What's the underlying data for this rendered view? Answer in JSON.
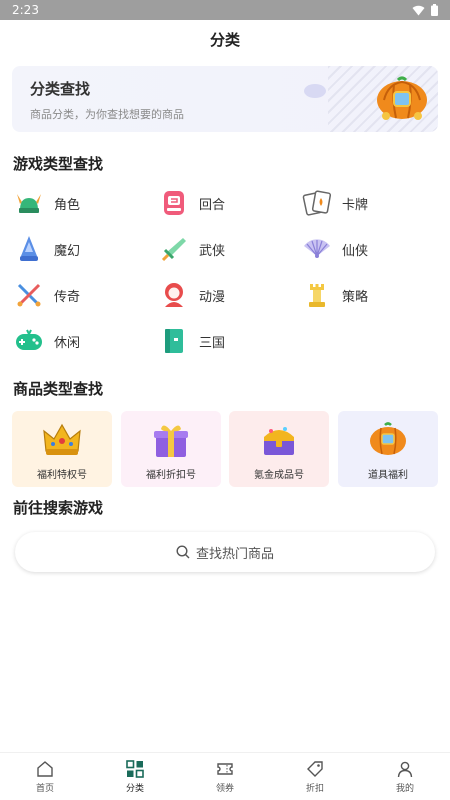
{
  "status": {
    "time": "2:23"
  },
  "header": {
    "title": "分类"
  },
  "banner": {
    "title": "分类查找",
    "subtitle": "商品分类，为你查找想要的商品"
  },
  "game_section": {
    "title": "游戏类型查找",
    "items": [
      {
        "label": "角色",
        "icon": "viking-helmet-icon"
      },
      {
        "label": "回合",
        "icon": "arcade-machine-icon"
      },
      {
        "label": "卡牌",
        "icon": "playing-card-icon"
      },
      {
        "label": "魔幻",
        "icon": "wizard-hat-icon"
      },
      {
        "label": "武侠",
        "icon": "sword-icon"
      },
      {
        "label": "仙侠",
        "icon": "folding-fan-icon"
      },
      {
        "label": "传奇",
        "icon": "crossed-swords-icon"
      },
      {
        "label": "动漫",
        "icon": "anime-character-icon"
      },
      {
        "label": "策略",
        "icon": "chess-rook-icon"
      },
      {
        "label": "休闲",
        "icon": "gamepad-icon"
      },
      {
        "label": "三国",
        "icon": "book-icon"
      }
    ]
  },
  "product_section": {
    "title": "商品类型查找",
    "items": [
      {
        "label": "福利特权号",
        "icon": "crown-icon",
        "bg": "#fff3e2"
      },
      {
        "label": "福利折扣号",
        "icon": "gift-box-icon",
        "bg": "#fdf0f8"
      },
      {
        "label": "氪金成品号",
        "icon": "treasure-chest-icon",
        "bg": "#fdecec"
      },
      {
        "label": "道具福利",
        "icon": "pumpkin-carriage-icon",
        "bg": "#eff0fc"
      }
    ]
  },
  "search_section": {
    "title": "前往搜索游戏",
    "placeholder": "查找热门商品"
  },
  "tabbar": {
    "active": "分类",
    "items": [
      {
        "label": "首页",
        "icon": "home-icon"
      },
      {
        "label": "分类",
        "icon": "category-grid-icon"
      },
      {
        "label": "领券",
        "icon": "coupon-icon"
      },
      {
        "label": "折扣",
        "icon": "tag-icon"
      },
      {
        "label": "我的",
        "icon": "user-icon"
      }
    ]
  },
  "colors": {
    "accent": "#1fb89a",
    "banner_bg": "#f2f3fb"
  }
}
